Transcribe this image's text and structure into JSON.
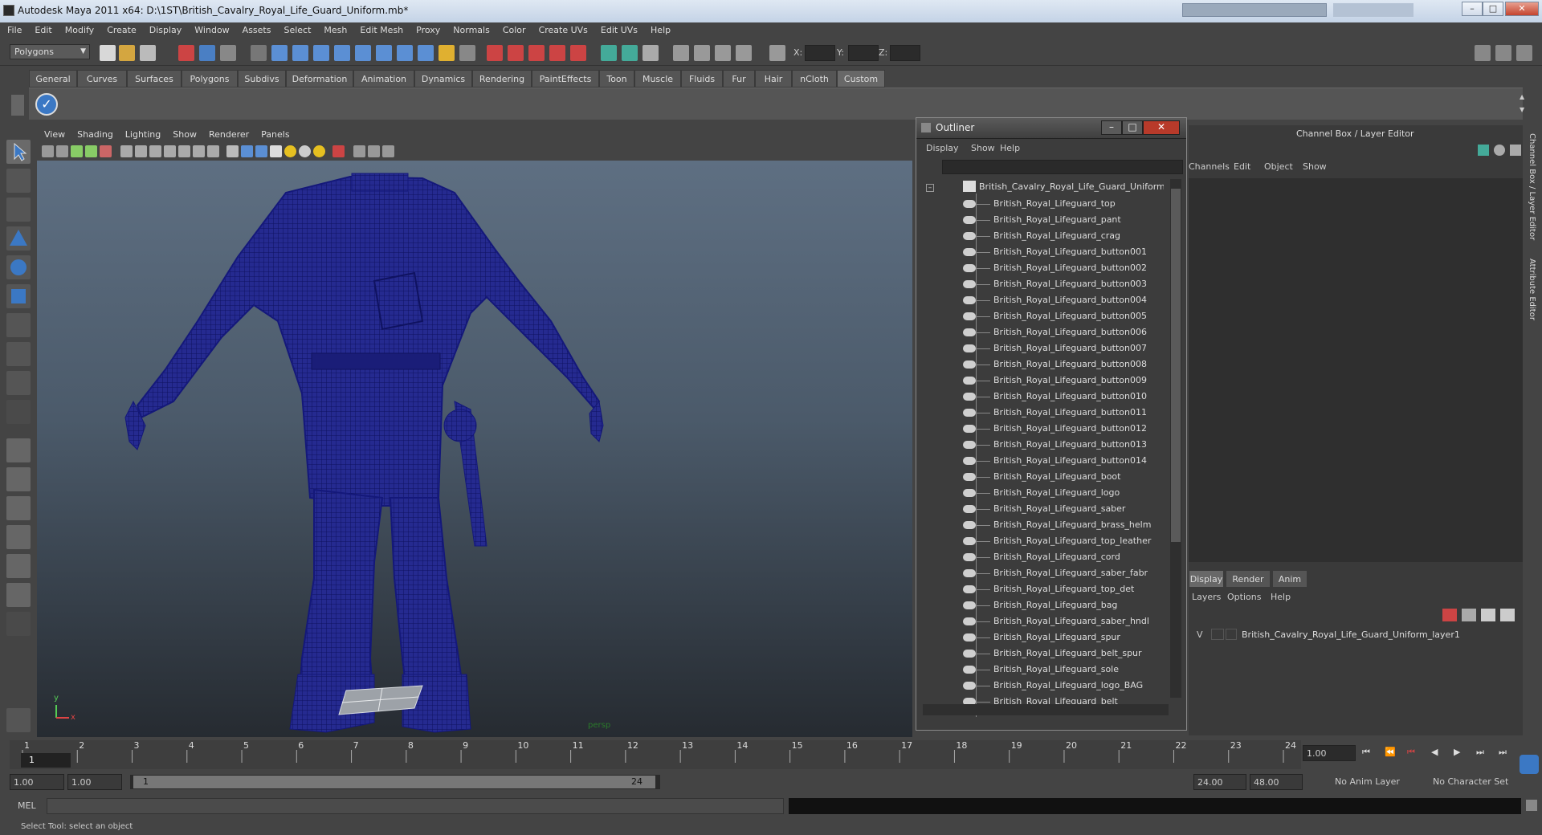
{
  "window": {
    "title": "Autodesk Maya 2011 x64: D:\\1ST\\British_Cavalry_Royal_Life_Guard_Uniform.mb*"
  },
  "menubar": [
    "File",
    "Edit",
    "Modify",
    "Create",
    "Display",
    "Window",
    "Assets",
    "Select",
    "Mesh",
    "Edit Mesh",
    "Proxy",
    "Normals",
    "Color",
    "Create UVs",
    "Edit UVs",
    "Help"
  ],
  "statusline": {
    "mode_dropdown": "Polygons",
    "x_label": "X:",
    "y_label": "Y:",
    "z_label": "Z:"
  },
  "shelf": {
    "tabs": [
      "General",
      "Curves",
      "Surfaces",
      "Polygons",
      "Subdivs",
      "Deformation",
      "Animation",
      "Dynamics",
      "Rendering",
      "PaintEffects",
      "Toon",
      "Muscle",
      "Fluids",
      "Fur",
      "Hair",
      "nCloth",
      "Custom"
    ],
    "active_tab": "Custom"
  },
  "viewport": {
    "menu": [
      "View",
      "Shading",
      "Lighting",
      "Show",
      "Renderer",
      "Panels"
    ],
    "camera_label": "persp",
    "axis_y": "y",
    "axis_x": "x"
  },
  "outliner": {
    "title": "Outliner",
    "menu": [
      "Display",
      "Show",
      "Help"
    ],
    "root": "British_Cavalry_Royal_Life_Guard_Uniform",
    "items": [
      "British_Royal_Lifeguard_top",
      "British_Royal_Lifeguard_pant",
      "British_Royal_Lifeguard_crag",
      "British_Royal_Lifeguard_button001",
      "British_Royal_Lifeguard_button002",
      "British_Royal_Lifeguard_button003",
      "British_Royal_Lifeguard_button004",
      "British_Royal_Lifeguard_button005",
      "British_Royal_Lifeguard_button006",
      "British_Royal_Lifeguard_button007",
      "British_Royal_Lifeguard_button008",
      "British_Royal_Lifeguard_button009",
      "British_Royal_Lifeguard_button010",
      "British_Royal_Lifeguard_button011",
      "British_Royal_Lifeguard_button012",
      "British_Royal_Lifeguard_button013",
      "British_Royal_Lifeguard_button014",
      "British_Royal_Lifeguard_boot",
      "British_Royal_Lifeguard_logo",
      "British_Royal_Lifeguard_saber",
      "British_Royal_Lifeguard_brass_helm",
      "British_Royal_Lifeguard_top_leather",
      "British_Royal_Lifeguard_cord",
      "British_Royal_Lifeguard_saber_fabr",
      "British_Royal_Lifeguard_top_det",
      "British_Royal_Lifeguard_bag",
      "British_Royal_Lifeguard_saber_hndl",
      "British_Royal_Lifeguard_spur",
      "British_Royal_Lifeguard_belt_spur",
      "British_Royal_Lifeguard_sole",
      "British_Royal_Lifeguard_logo_BAG",
      "British_Royal_Lifeguard_belt"
    ]
  },
  "channelbox": {
    "title": "Channel Box / Layer Editor",
    "menu": [
      "Channels",
      "Edit",
      "Object",
      "Show"
    ],
    "layer_tabs": [
      "Display",
      "Render",
      "Anim"
    ],
    "layer_menu": [
      "Layers",
      "Options",
      "Help"
    ],
    "layer_visible": "V",
    "layer_name": "British_Cavalry_Royal_Life_Guard_Uniform_layer1",
    "side_tab_1": "Channel Box / Layer Editor",
    "side_tab_2": "Attribute Editor"
  },
  "timeline": {
    "ticks": [
      "1",
      "2",
      "3",
      "4",
      "5",
      "6",
      "7",
      "8",
      "9",
      "10",
      "11",
      "12",
      "13",
      "14",
      "15",
      "16",
      "17",
      "18",
      "19",
      "20",
      "21",
      "22",
      "23",
      "24"
    ],
    "current_frame_marker": "1",
    "current_time": "1.00",
    "range_start": "1.00",
    "playback_start": "1.00",
    "range_slider_start": "1",
    "range_slider_end": "24",
    "playback_end": "24.00",
    "range_end": "48.00",
    "anim_layer": "No Anim Layer",
    "character_set": "No Character Set"
  },
  "cmdline": {
    "label": "MEL"
  },
  "helpline": {
    "text": "Select Tool: select an object"
  },
  "colors": {
    "wireframe": "#1a1a8c",
    "viewport_top": "#5e6f82",
    "viewport_bottom": "#262b31"
  }
}
